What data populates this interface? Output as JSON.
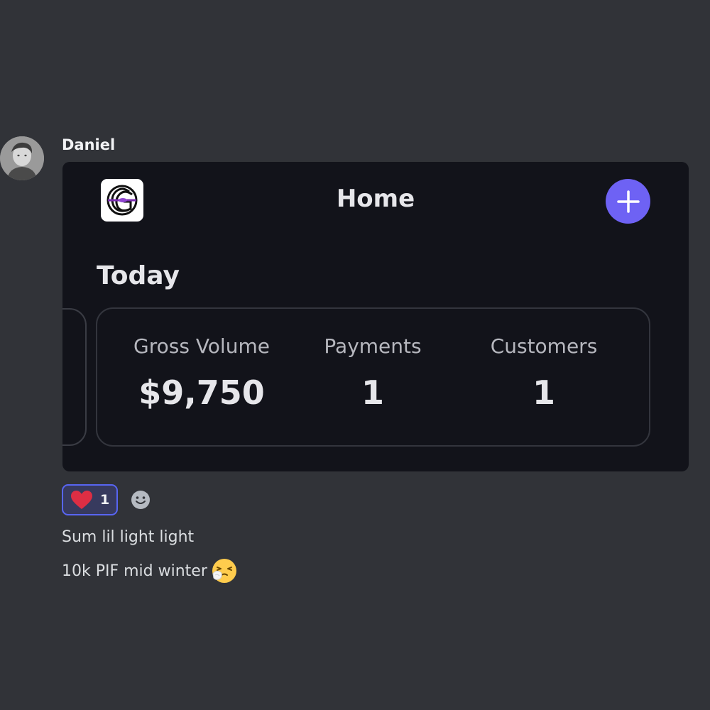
{
  "message": {
    "author": "Daniel",
    "lines": [
      "Sum lil light light",
      "10k PIF mid winter"
    ],
    "emoji_icon": "sneezing-face-icon"
  },
  "app": {
    "title": "Home",
    "logo_icon": "brand-logo-icon",
    "add_icon": "plus-icon",
    "accent_color": "#6e62f4"
  },
  "today": {
    "section_title": "Today",
    "stats": [
      {
        "label": "Gross Volume",
        "value": "$9,750"
      },
      {
        "label": "Payments",
        "value": "1"
      },
      {
        "label": "Customers",
        "value": "1"
      }
    ]
  },
  "reactions": [
    {
      "icon": "heart-icon",
      "count": "1"
    }
  ],
  "add_reaction_icon": "smiley-icon"
}
